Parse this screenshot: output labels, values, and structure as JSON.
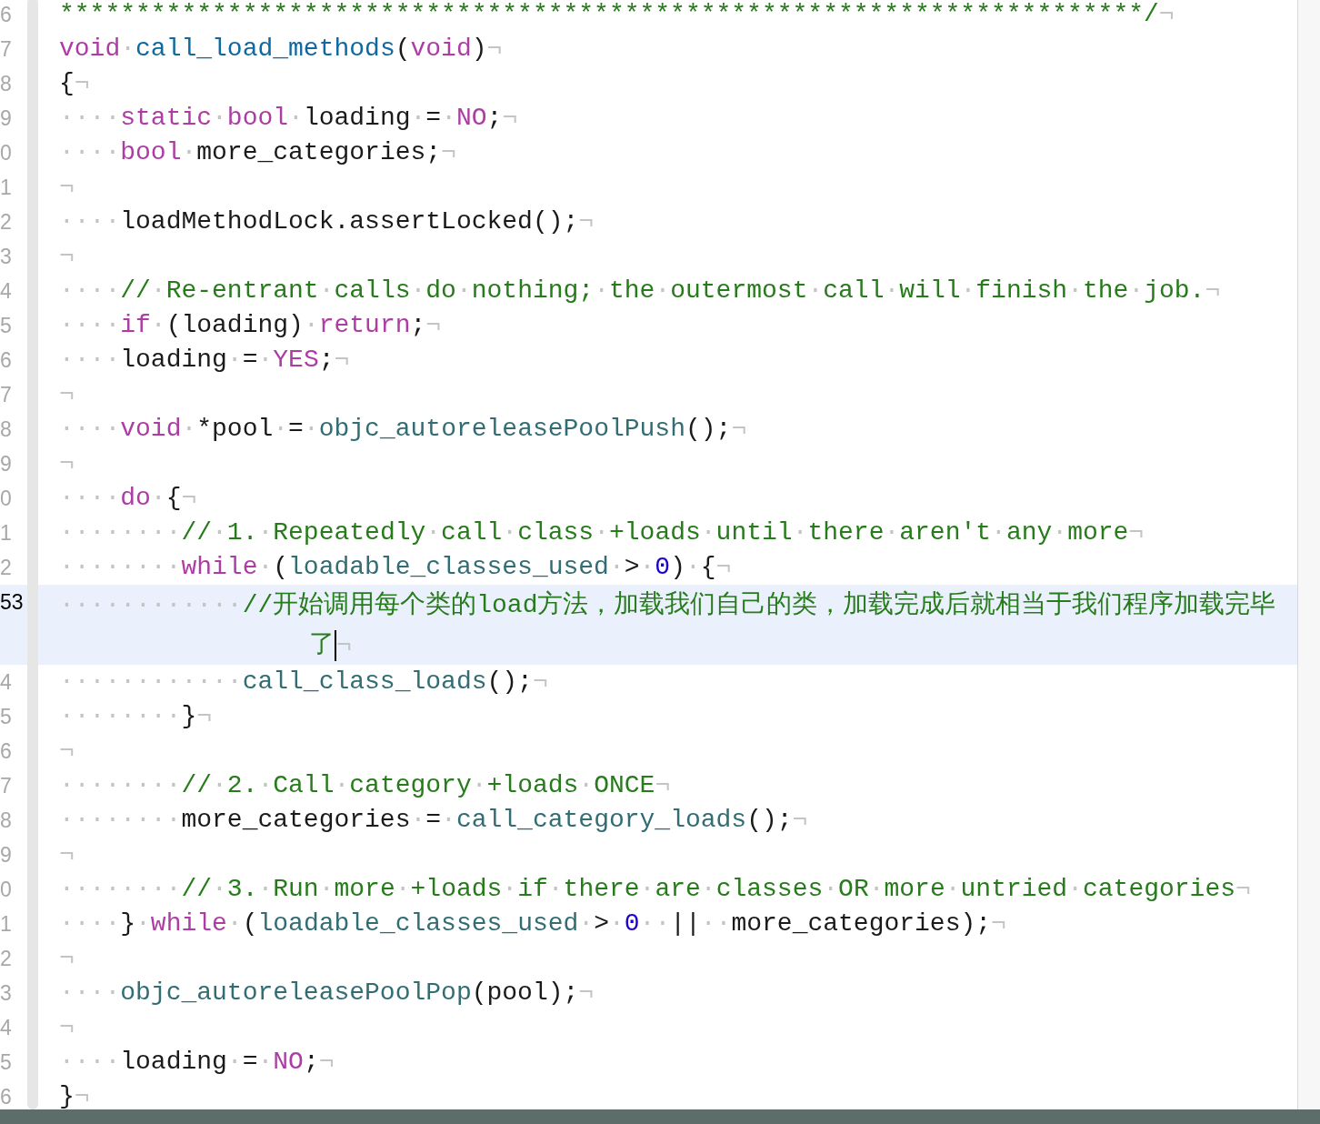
{
  "lines": [
    {
      "number": "6",
      "current": false,
      "tokens": [
        {
          "kind": "comment",
          "text": "***********************************************************************/"
        },
        {
          "kind": "plain",
          "text": "¬"
        }
      ]
    },
    {
      "number": "7",
      "current": false,
      "tokens": [
        {
          "kind": "keyword",
          "text": "void"
        },
        {
          "kind": "plain",
          "text": "·"
        },
        {
          "kind": "function",
          "text": "call_load_methods"
        },
        {
          "kind": "plain",
          "text": "("
        },
        {
          "kind": "keyword",
          "text": "void"
        },
        {
          "kind": "plain",
          "text": ")¬"
        }
      ]
    },
    {
      "number": "8",
      "current": false,
      "tokens": [
        {
          "kind": "plain",
          "text": "{¬"
        }
      ]
    },
    {
      "number": "9",
      "current": false,
      "tokens": [
        {
          "kind": "plain",
          "text": "····"
        },
        {
          "kind": "keyword",
          "text": "static"
        },
        {
          "kind": "plain",
          "text": "·"
        },
        {
          "kind": "keyword",
          "text": "bool"
        },
        {
          "kind": "plain",
          "text": "·loading·=·"
        },
        {
          "kind": "keyword",
          "text": "NO"
        },
        {
          "kind": "plain",
          "text": ";¬"
        }
      ]
    },
    {
      "number": "0",
      "current": false,
      "tokens": [
        {
          "kind": "plain",
          "text": "····"
        },
        {
          "kind": "keyword",
          "text": "bool"
        },
        {
          "kind": "plain",
          "text": "·more_categories;¬"
        }
      ]
    },
    {
      "number": "1",
      "current": false,
      "tokens": [
        {
          "kind": "plain",
          "text": "¬"
        }
      ]
    },
    {
      "number": "2",
      "current": false,
      "tokens": [
        {
          "kind": "plain",
          "text": "····loadMethodLock.assertLocked();¬"
        }
      ]
    },
    {
      "number": "3",
      "current": false,
      "tokens": [
        {
          "kind": "plain",
          "text": "¬"
        }
      ]
    },
    {
      "number": "4",
      "current": false,
      "tokens": [
        {
          "kind": "plain",
          "text": "····"
        },
        {
          "kind": "comment",
          "text": "//·Re-entrant·calls·do·nothing;·the·outermost·call·will·finish·the·job."
        },
        {
          "kind": "plain",
          "text": "¬"
        }
      ]
    },
    {
      "number": "5",
      "current": false,
      "tokens": [
        {
          "kind": "plain",
          "text": "····"
        },
        {
          "kind": "keyword",
          "text": "if"
        },
        {
          "kind": "plain",
          "text": "·(loading)·"
        },
        {
          "kind": "keyword",
          "text": "return"
        },
        {
          "kind": "plain",
          "text": ";¬"
        }
      ]
    },
    {
      "number": "6",
      "current": false,
      "tokens": [
        {
          "kind": "plain",
          "text": "····loading·=·"
        },
        {
          "kind": "keyword",
          "text": "YES"
        },
        {
          "kind": "plain",
          "text": ";¬"
        }
      ]
    },
    {
      "number": "7",
      "current": false,
      "tokens": [
        {
          "kind": "plain",
          "text": "¬"
        }
      ]
    },
    {
      "number": "8",
      "current": false,
      "tokens": [
        {
          "kind": "plain",
          "text": "····"
        },
        {
          "kind": "keyword",
          "text": "void"
        },
        {
          "kind": "plain",
          "text": "·*pool·=·"
        },
        {
          "kind": "call",
          "text": "objc_autoreleasePoolPush"
        },
        {
          "kind": "plain",
          "text": "();¬"
        }
      ]
    },
    {
      "number": "9",
      "current": false,
      "tokens": [
        {
          "kind": "plain",
          "text": "¬"
        }
      ]
    },
    {
      "number": "0",
      "current": false,
      "tokens": [
        {
          "kind": "plain",
          "text": "····"
        },
        {
          "kind": "keyword",
          "text": "do"
        },
        {
          "kind": "plain",
          "text": "·{¬"
        }
      ]
    },
    {
      "number": "1",
      "current": false,
      "tokens": [
        {
          "kind": "plain",
          "text": "········"
        },
        {
          "kind": "comment",
          "text": "//·1.·Repeatedly·call·class·+loads·until·there·aren't·any·more"
        },
        {
          "kind": "plain",
          "text": "¬"
        }
      ]
    },
    {
      "number": "2",
      "current": false,
      "tokens": [
        {
          "kind": "plain",
          "text": "········"
        },
        {
          "kind": "keyword",
          "text": "while"
        },
        {
          "kind": "plain",
          "text": "·("
        },
        {
          "kind": "call",
          "text": "loadable_classes_used"
        },
        {
          "kind": "plain",
          "text": "·>·"
        },
        {
          "kind": "number",
          "text": "0"
        },
        {
          "kind": "plain",
          "text": ")·{¬"
        }
      ]
    },
    {
      "number": "53",
      "current": true,
      "tokens": [
        {
          "kind": "plain",
          "text": "············"
        },
        {
          "kind": "comment",
          "text": "//开始调用每个类的load方法，加载我们自己的类，加载完成后就相当于我们程序加载完毕"
        }
      ],
      "wrapped": [
        {
          "kind": "comment",
          "text": "了"
        },
        {
          "kind": "plain",
          "text": "¬"
        }
      ]
    },
    {
      "number": "4",
      "current": false,
      "tokens": [
        {
          "kind": "plain",
          "text": "············"
        },
        {
          "kind": "call",
          "text": "call_class_loads"
        },
        {
          "kind": "plain",
          "text": "();¬"
        }
      ]
    },
    {
      "number": "5",
      "current": false,
      "tokens": [
        {
          "kind": "plain",
          "text": "········}¬"
        }
      ]
    },
    {
      "number": "6",
      "current": false,
      "tokens": [
        {
          "kind": "plain",
          "text": "¬"
        }
      ]
    },
    {
      "number": "7",
      "current": false,
      "tokens": [
        {
          "kind": "plain",
          "text": "········"
        },
        {
          "kind": "comment",
          "text": "//·2.·Call·category·+loads·ONCE"
        },
        {
          "kind": "plain",
          "text": "¬"
        }
      ]
    },
    {
      "number": "8",
      "current": false,
      "tokens": [
        {
          "kind": "plain",
          "text": "········more_categories·=·"
        },
        {
          "kind": "call",
          "text": "call_category_loads"
        },
        {
          "kind": "plain",
          "text": "();¬"
        }
      ]
    },
    {
      "number": "9",
      "current": false,
      "tokens": [
        {
          "kind": "plain",
          "text": "¬"
        }
      ]
    },
    {
      "number": "0",
      "current": false,
      "tokens": [
        {
          "kind": "plain",
          "text": "········"
        },
        {
          "kind": "comment",
          "text": "//·3.·Run·more·+loads·if·there·are·classes·OR·more·untried·categories"
        },
        {
          "kind": "plain",
          "text": "¬"
        }
      ]
    },
    {
      "number": "1",
      "current": false,
      "tokens": [
        {
          "kind": "plain",
          "text": "····}·"
        },
        {
          "kind": "keyword",
          "text": "while"
        },
        {
          "kind": "plain",
          "text": "·("
        },
        {
          "kind": "call",
          "text": "loadable_classes_used"
        },
        {
          "kind": "plain",
          "text": "·>·"
        },
        {
          "kind": "number",
          "text": "0"
        },
        {
          "kind": "plain",
          "text": "··||··more_categories);¬"
        }
      ]
    },
    {
      "number": "2",
      "current": false,
      "tokens": [
        {
          "kind": "plain",
          "text": "¬"
        }
      ]
    },
    {
      "number": "3",
      "current": false,
      "tokens": [
        {
          "kind": "plain",
          "text": "····"
        },
        {
          "kind": "call",
          "text": "objc_autoreleasePoolPop"
        },
        {
          "kind": "plain",
          "text": "(pool);¬"
        }
      ]
    },
    {
      "number": "4",
      "current": false,
      "tokens": [
        {
          "kind": "plain",
          "text": "¬"
        }
      ]
    },
    {
      "number": "5",
      "current": false,
      "tokens": [
        {
          "kind": "plain",
          "text": "····loading·=·"
        },
        {
          "kind": "keyword",
          "text": "NO"
        },
        {
          "kind": "plain",
          "text": ";¬"
        }
      ]
    },
    {
      "number": "6",
      "current": false,
      "tokens": [
        {
          "kind": "plain",
          "text": "}¬"
        }
      ]
    }
  ]
}
